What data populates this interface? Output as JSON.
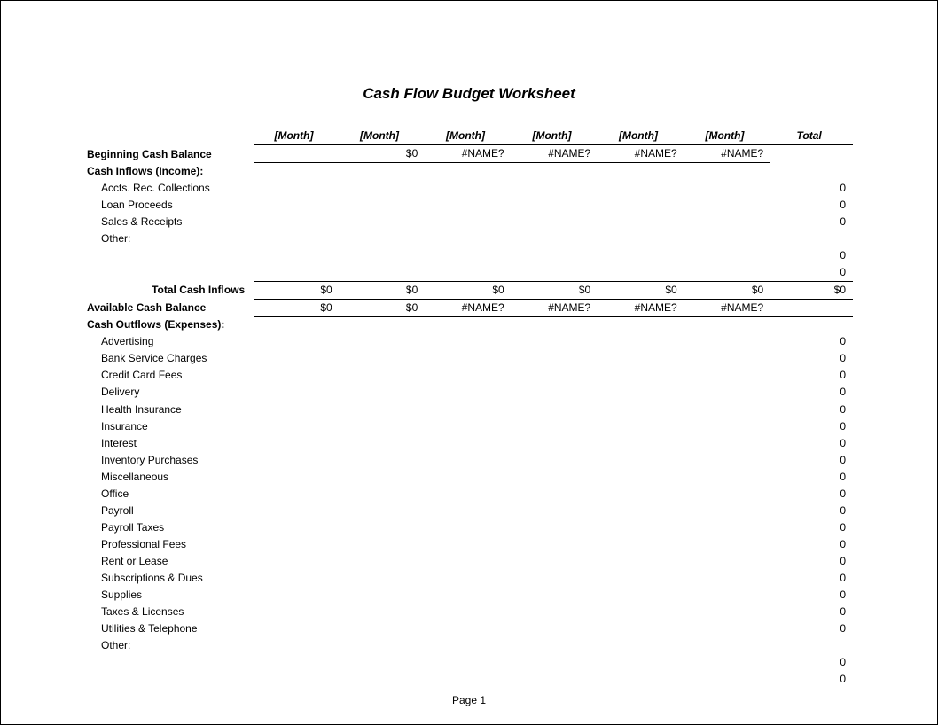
{
  "title": "Cash Flow Budget Worksheet",
  "headers": {
    "month": "[Month]",
    "total": "Total"
  },
  "rows": {
    "beginning": {
      "label": "Beginning Cash Balance",
      "m": [
        "",
        "$0",
        "#NAME?",
        "#NAME?",
        "#NAME?",
        "#NAME?"
      ],
      "t": ""
    },
    "inflows_header": "Cash Inflows (Income):",
    "inflow_items": [
      {
        "label": "Accts. Rec. Collections",
        "t": "0"
      },
      {
        "label": "Loan Proceeds",
        "t": "0"
      },
      {
        "label": "Sales & Receipts",
        "t": "0"
      },
      {
        "label": "Other:",
        "t": ""
      }
    ],
    "inflow_blanks": [
      {
        "t": "0"
      },
      {
        "t": "0"
      }
    ],
    "total_inflows": {
      "label": "Total Cash Inflows",
      "m": [
        "$0",
        "$0",
        "$0",
        "$0",
        "$0",
        "$0"
      ],
      "t": "$0"
    },
    "available": {
      "label": "Available Cash Balance",
      "m": [
        "$0",
        "$0",
        "#NAME?",
        "#NAME?",
        "#NAME?",
        "#NAME?"
      ],
      "t": ""
    },
    "outflows_header": "Cash Outflows (Expenses):",
    "outflow_items": [
      {
        "label": "Advertising",
        "t": "0"
      },
      {
        "label": "Bank Service Charges",
        "t": "0"
      },
      {
        "label": "Credit Card Fees",
        "t": "0"
      },
      {
        "label": "Delivery",
        "t": "0"
      },
      {
        "label": "Health Insurance",
        "t": "0"
      },
      {
        "label": "Insurance",
        "t": "0"
      },
      {
        "label": "Interest",
        "t": "0"
      },
      {
        "label": "Inventory Purchases",
        "t": "0"
      },
      {
        "label": "Miscellaneous",
        "t": "0"
      },
      {
        "label": "Office",
        "t": "0"
      },
      {
        "label": "Payroll",
        "t": "0"
      },
      {
        "label": "Payroll Taxes",
        "t": "0"
      },
      {
        "label": "Professional Fees",
        "t": "0"
      },
      {
        "label": "Rent or Lease",
        "t": "0"
      },
      {
        "label": "Subscriptions & Dues",
        "t": "0"
      },
      {
        "label": "Supplies",
        "t": "0"
      },
      {
        "label": "Taxes & Licenses",
        "t": "0"
      },
      {
        "label": "Utilities & Telephone",
        "t": "0"
      },
      {
        "label": "Other:",
        "t": ""
      }
    ],
    "outflow_blanks": [
      {
        "t": "0"
      },
      {
        "t": "0"
      }
    ]
  },
  "footer": "Page 1"
}
